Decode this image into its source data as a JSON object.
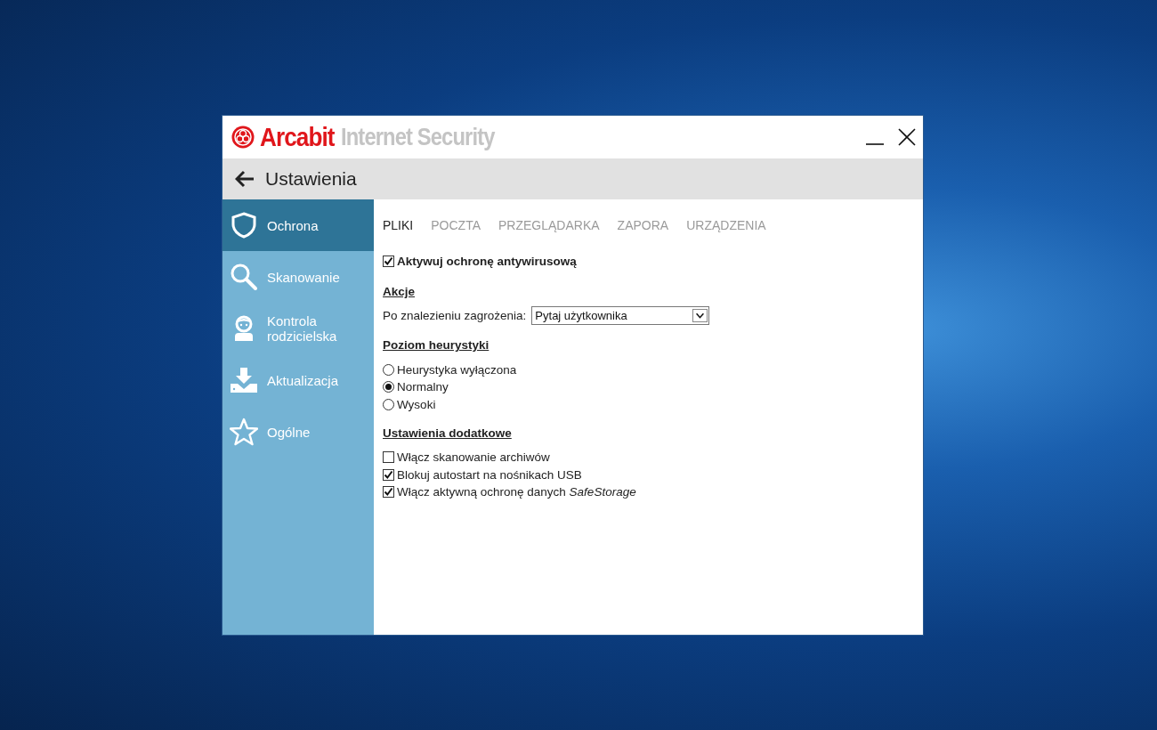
{
  "window": {
    "brand": "Arcabit",
    "product": "Internet Security",
    "controls": [
      {
        "kind": "minimize"
      },
      {
        "kind": "close"
      }
    ]
  },
  "header": {
    "title": "Ustawienia"
  },
  "sidebar": {
    "items": [
      {
        "label": "Ochrona",
        "kind": "shield",
        "selected": true
      },
      {
        "label": "Skanowanie",
        "kind": "search",
        "selected": false
      },
      {
        "label": "Kontrola rodzicielska",
        "kind": "child",
        "selected": false
      },
      {
        "label": "Aktualizacja",
        "kind": "download",
        "selected": false
      },
      {
        "label": "Ogólne",
        "kind": "star",
        "selected": false
      }
    ]
  },
  "tabs": [
    {
      "label": "PLIKI",
      "selected": true
    },
    {
      "label": "POCZTA",
      "selected": false
    },
    {
      "label": "PRZEGLĄDARKA",
      "selected": false
    },
    {
      "label": "ZAPORA",
      "selected": false
    },
    {
      "label": "URZĄDZENIA",
      "selected": false
    }
  ],
  "main_toggle": {
    "label": "Aktywuj ochronę antywirusową",
    "checked": true
  },
  "actions": {
    "heading": "Akcje",
    "label": "Po znalezieniu zagrożenia:",
    "value": "Pytaj użytkownika"
  },
  "heuristics": {
    "heading": "Poziom heurystyki",
    "options": [
      {
        "label": "Heurystyka wyłączona",
        "selected": false
      },
      {
        "label": "Normalny",
        "selected": true
      },
      {
        "label": "Wysoki",
        "selected": false
      }
    ]
  },
  "extra": {
    "heading": "Ustawienia dodatkowe",
    "options": [
      {
        "label": "Włącz skanowanie archiwów",
        "checked": false
      },
      {
        "label": "Blokuj autostart na nośnikach USB",
        "checked": true
      },
      {
        "label": "Włącz aktywną ochronę danych *SafeStorage*",
        "checked": true
      }
    ]
  }
}
